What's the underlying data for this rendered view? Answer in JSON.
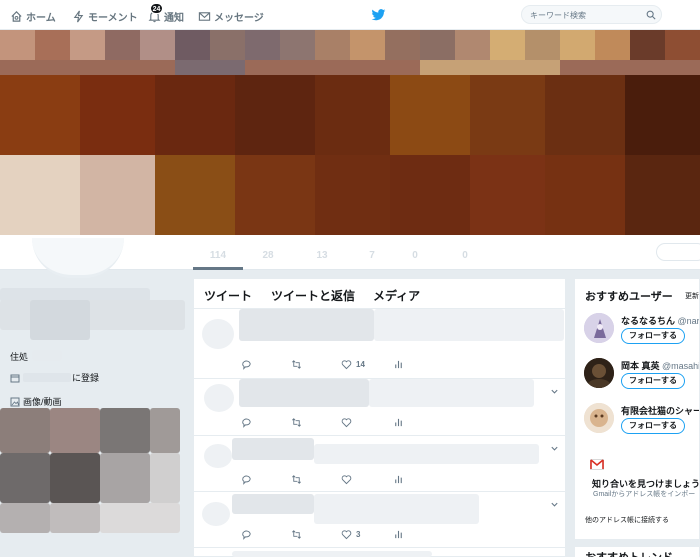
{
  "nav": {
    "home": "ホーム",
    "moments": "モーメント",
    "notifications": "通知",
    "notifications_badge": "24",
    "messages": "メッセージ",
    "search_placeholder": "キーワード検索"
  },
  "colors": {
    "accent": "#1da1f2",
    "text_primary": "#14171a",
    "text_secondary": "#657786",
    "background": "#e6ecf0",
    "gmail_red": "#d93025"
  },
  "profile_stats": [
    "114",
    "28",
    "13",
    "7",
    "0",
    "0"
  ],
  "left_col": {
    "location_label": "住処",
    "joined_suffix": "に登録",
    "media_label": "画像/動画"
  },
  "timeline": {
    "tabs": [
      "ツイート",
      "ツイートと返信",
      "メディア"
    ],
    "tweets": [
      {
        "likes": "14"
      },
      {
        "likes": ""
      },
      {
        "likes": ""
      },
      {
        "likes": "3"
      }
    ]
  },
  "suggestions": {
    "title": "おすすめユーザー",
    "refresh": "更新",
    "follow_label": "フォローする",
    "users": [
      {
        "name": "なるなるちん",
        "handle": "@nar"
      },
      {
        "name": "岡本 真英",
        "handle": "@masahi"
      },
      {
        "name": "有限会社猫のシャー",
        "handle": ""
      }
    ],
    "gmail_title": "知り合いを見つけましょう",
    "gmail_sub": "Gmailからアドレス帳をインポー",
    "other_link": "他のアドレス帳に接続する"
  },
  "trends": {
    "title": "おすすめトレンド"
  }
}
